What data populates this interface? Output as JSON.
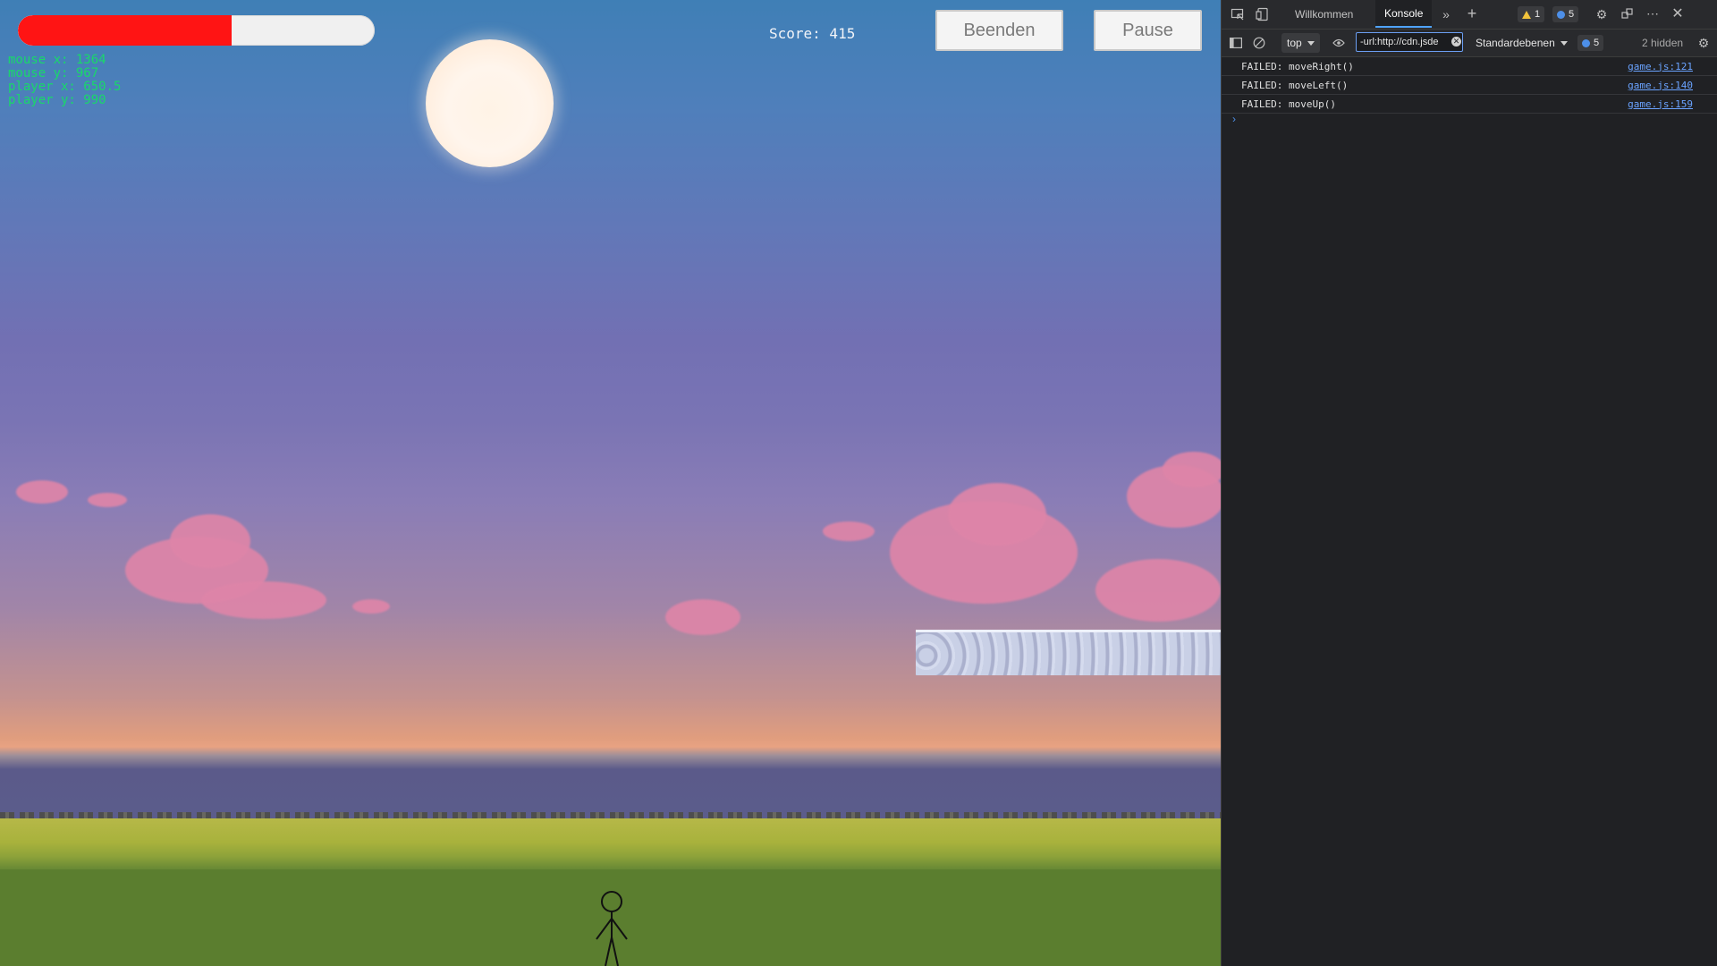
{
  "game": {
    "health_fraction": 0.6,
    "debug": {
      "mouse_x": "mouse x: 1364",
      "mouse_y": "mouse y: 967",
      "player_x": "player x: 650.5",
      "player_y": "player y: 990"
    },
    "score": "Score: 415",
    "buttons": {
      "quit": "Beenden",
      "pause": "Pause"
    },
    "colors": {
      "health": "#ff1414",
      "debug_text": "#19d86a"
    }
  },
  "devtools": {
    "tabs": {
      "welcome": "Willkommen",
      "console": "Konsole"
    },
    "badges": {
      "warnings": "1",
      "info": "5",
      "toolbar_info": "5"
    },
    "toolbar": {
      "context": "top",
      "filter_value": "-url:http://cdn.jsde",
      "levels": "Standardebenen",
      "hidden": "2 hidden"
    },
    "console": [
      {
        "message": "FAILED: moveRight()",
        "source": "game.js:121"
      },
      {
        "message": "FAILED: moveLeft()",
        "source": "game.js:140"
      },
      {
        "message": "FAILED: moveUp()",
        "source": "game.js:159"
      }
    ],
    "prompt": "›"
  }
}
